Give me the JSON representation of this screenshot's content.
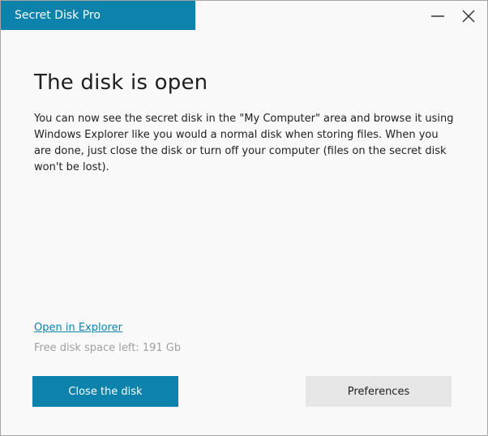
{
  "window": {
    "title": "Secret Disk Pro",
    "accent_color": "#0d82ab"
  },
  "controls": {
    "minimize_icon": "minimize-icon",
    "close_icon": "close-icon"
  },
  "main": {
    "heading": "The disk is open",
    "description": "You can now see the secret disk in the \"My Computer\" area and browse it using Windows Explorer like you would a normal disk when storing files. When you are done, just close the disk or turn off your computer (files on the secret disk won't be lost).",
    "open_explorer_link": "Open in Explorer",
    "free_space_text": "Free disk space left: 191 Gb"
  },
  "buttons": {
    "close_disk_label": "Close the disk",
    "preferences_label": "Preferences"
  }
}
